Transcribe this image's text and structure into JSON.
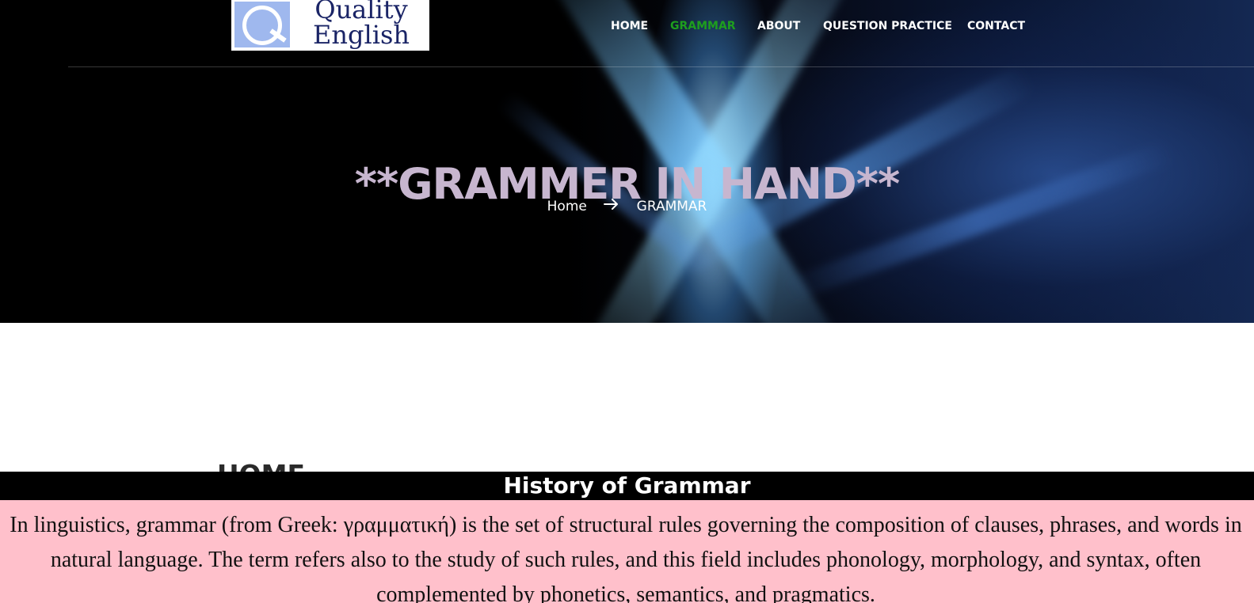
{
  "logo": {
    "line1": "Quality",
    "line2": "English",
    "colors": {
      "text": "#1a2466",
      "mark": "#9fb8ee"
    }
  },
  "nav": {
    "items": [
      {
        "label": "HOME",
        "active": false
      },
      {
        "label": "GRAMMAR",
        "active": true
      },
      {
        "label": "ABOUT",
        "active": false
      },
      {
        "label": "QUESTION PRACTICE",
        "active": false
      },
      {
        "label": "CONTACT",
        "active": false
      }
    ],
    "active_color": "#1e9e1e"
  },
  "hero": {
    "title": "**GRAMMER IN HAND**",
    "breadcrumb": {
      "home": "Home",
      "separator_icon": "arrow-right-icon",
      "current": "GRAMMAR"
    }
  },
  "section": {
    "dashes_left": "--------------------",
    "heading": "HOME",
    "dashes_right": "-------------------------------",
    "subheading": "History of Grammar",
    "paragraph": "In linguistics, grammar (from Greek: γραμματική) is the set of structural rules governing the composition of clauses, phrases, and words in natural language. The term refers also to the study of such rules, and this field includes phonology, morphology, and syntax, often complemented by phonetics, semantics, and pragmatics."
  },
  "colors": {
    "subheading_bar": "#000000",
    "content_background": "#ffc0cb",
    "hero_title": "#c7b6cf"
  }
}
